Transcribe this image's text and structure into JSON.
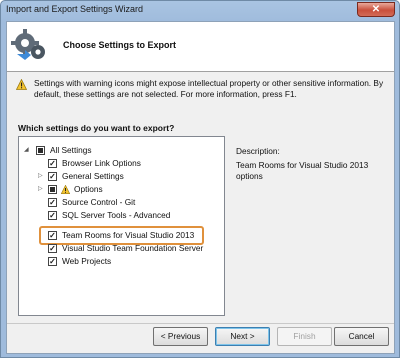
{
  "window": {
    "title": "Import and Export Settings Wizard",
    "close_label": "✕"
  },
  "header": {
    "title": "Choose Settings to Export"
  },
  "warning": {
    "text": "Settings with warning icons might expose intellectual property or other sensitive information. By default, these settings are not selected. For more information, press F1."
  },
  "tree": {
    "question": "Which settings do you want to export?",
    "items": [
      {
        "label": "All Settings",
        "check": "partial",
        "expander": "◢"
      },
      {
        "label": "Browser Link Options",
        "check": "checked",
        "expander": ""
      },
      {
        "label": "General Settings",
        "check": "checked",
        "expander": "▷"
      },
      {
        "label": "Options",
        "check": "partial",
        "expander": "▷",
        "warning": true
      },
      {
        "label": "Source Control - Git",
        "check": "checked",
        "expander": ""
      },
      {
        "label": "SQL Server Tools - Advanced",
        "check": "checked",
        "expander": ""
      },
      {
        "label": "Team Rooms for Visual Studio 2013",
        "check": "checked",
        "expander": ""
      },
      {
        "label": "Visual Studio Team Foundation Server",
        "check": "checked",
        "expander": ""
      },
      {
        "label": "Web Projects",
        "check": "checked",
        "expander": ""
      }
    ]
  },
  "description": {
    "label": "Description:",
    "text": "Team Rooms for Visual Studio 2013 options"
  },
  "buttons": {
    "previous": "< Previous",
    "next": "Next >",
    "finish": "Finish",
    "cancel": "Cancel"
  },
  "colors": {
    "highlight": "#e0913c",
    "title_bar": "#a9c4e2",
    "close": "#c9503c"
  }
}
